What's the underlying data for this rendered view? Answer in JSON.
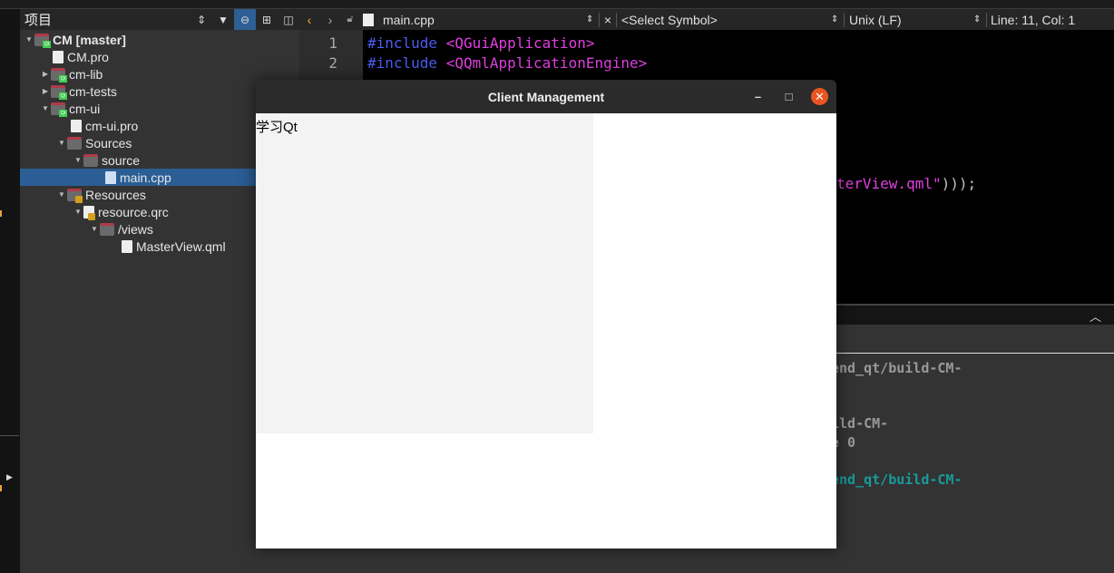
{
  "project_panel": {
    "title": "项目",
    "tree": [
      {
        "label": "CM [master]",
        "bold": true
      },
      {
        "label": "CM.pro"
      },
      {
        "label": "cm-lib"
      },
      {
        "label": "cm-tests"
      },
      {
        "label": "cm-ui"
      },
      {
        "label": "cm-ui.pro"
      },
      {
        "label": "Sources"
      },
      {
        "label": "source"
      },
      {
        "label": "main.cpp",
        "selected": true
      },
      {
        "label": "Resources"
      },
      {
        "label": "resource.qrc"
      },
      {
        "label": "/views"
      },
      {
        "label": "MasterView.qml"
      }
    ]
  },
  "editor": {
    "file": "main.cpp",
    "symbol": "<Select Symbol>",
    "line_ending": "Unix (LF)",
    "position": "Line: 11, Col: 1",
    "lines": [
      {
        "num": "1",
        "directive": "#include",
        "header": "<QGuiApplication>"
      },
      {
        "num": "2",
        "directive": "#include",
        "header": "<QQmlApplicationEngine>"
      }
    ],
    "fragment_text": "terView.qml\"",
    "fragment_punct": ")));"
  },
  "output": {
    "lines": [
      "end_qt/build-CM-",
      ".",
      "ild-CM-",
      "e 0",
      "end_qt/build-CM-",
      "."
    ]
  },
  "client_window": {
    "title": "Client Management",
    "content_text": "学习Qt"
  },
  "colors": {
    "accent": "#2a5e95",
    "close": "#e95420",
    "keyword": "#4a5cf0",
    "include": "#e040e0"
  }
}
